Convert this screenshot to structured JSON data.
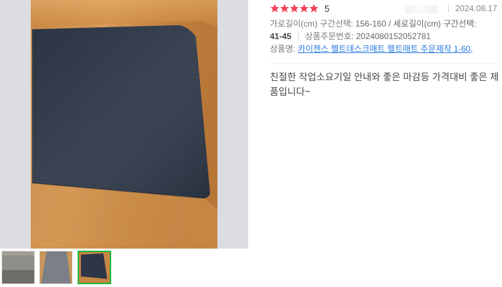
{
  "review": {
    "rating_stars": 5,
    "rating_value": "5",
    "date": "2024.08.17",
    "options_label_1": "가로길이(cm) 구간선택:",
    "options_value_1": "156-160 / 세로길이(cm) 구간선택:",
    "options_value_2": "41-45",
    "order_label": "상품주문번호:",
    "order_number": "2024080152052781",
    "product_label": "상품명:",
    "product_name": "카이젠스 펠트데스크매트 펠트매트 주문제작 1-60,",
    "body": "친절한 작업소요기일 안내와 좋은 마감등 가격대비 좋은 제품입니다~"
  },
  "colors": {
    "star": "#f5445a",
    "link": "#2a7ae2",
    "active_thumb_border": "#1db83a"
  },
  "thumbnails": [
    {
      "name": "thumbnail-1",
      "active": false
    },
    {
      "name": "thumbnail-2",
      "active": false
    },
    {
      "name": "thumbnail-3",
      "active": true
    }
  ]
}
